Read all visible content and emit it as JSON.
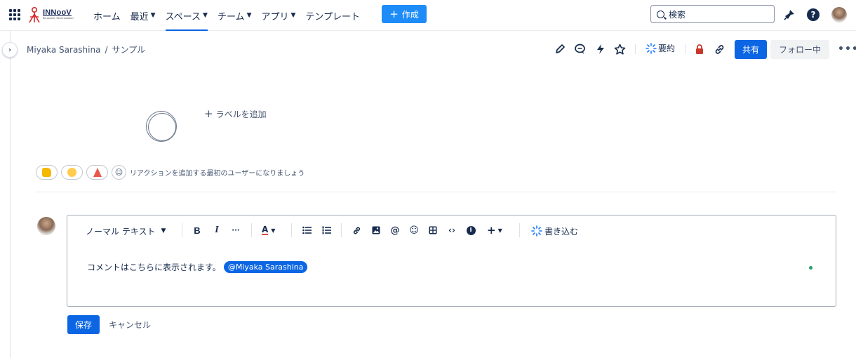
{
  "logo": {
    "name": "INNooV",
    "tagline": "Re-search, Re-innovation"
  },
  "nav": {
    "items": [
      {
        "label": "ホーム",
        "dropdown": false,
        "active": false
      },
      {
        "label": "最近",
        "dropdown": true,
        "active": false
      },
      {
        "label": "スペース",
        "dropdown": true,
        "active": true
      },
      {
        "label": "チーム",
        "dropdown": true,
        "active": false
      },
      {
        "label": "アプリ",
        "dropdown": true,
        "active": false
      },
      {
        "label": "テンプレート",
        "dropdown": false,
        "active": false
      }
    ],
    "create_label": "作成",
    "search_placeholder": "検索"
  },
  "breadcrumb": {
    "space": "Miyaka Sarashina",
    "separator": "/",
    "page": "サンプル"
  },
  "page_toolbar": {
    "summary_label": "要約",
    "share_label": "共有",
    "follow_label": "フォロー中",
    "more_label": "•••"
  },
  "labels": {
    "add_label": "ラベルを追加"
  },
  "reactions": {
    "prompt": "リアクションを追加する最初のユーザーになりましょう"
  },
  "editor": {
    "text_style": "ノーマル テキスト",
    "write_label": "書き込む",
    "comment_text": "コメントはこちらに表示されます。",
    "mention": "@Miyaka Sarashina"
  },
  "actions": {
    "save_label": "保存",
    "cancel_label": "キャンセル"
  },
  "colors": {
    "primary": "#0c66e4",
    "create": "#1d8cf8",
    "lock": "#c9372c",
    "online": "#22a06b"
  }
}
